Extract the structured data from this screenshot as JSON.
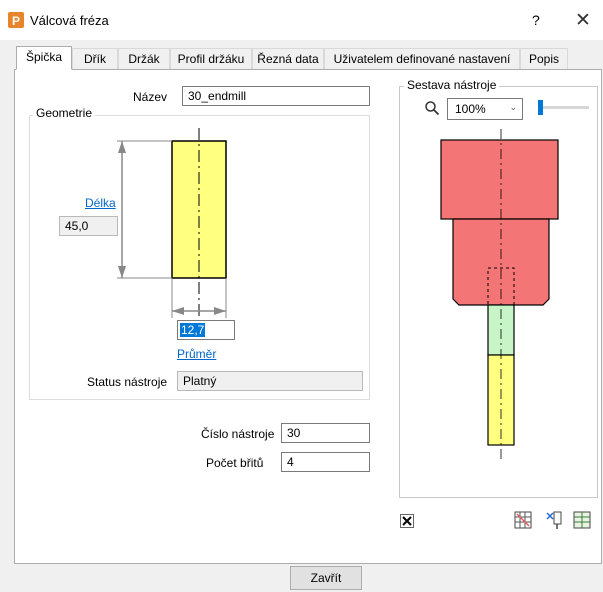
{
  "window": {
    "title": "Válcová fréza",
    "help_label": "?",
    "close_label": "✕"
  },
  "tabs": [
    {
      "label": "Špička",
      "active": true
    },
    {
      "label": "Dřík"
    },
    {
      "label": "Držák"
    },
    {
      "label": "Profil držáku"
    },
    {
      "label": "Řezná data"
    },
    {
      "label": "Uživatelem definované nastavení"
    },
    {
      "label": "Popis"
    }
  ],
  "tip": {
    "name_label": "Název",
    "name_value": "30_endmill",
    "geometry_legend": "Geometrie",
    "length_label": "Délka",
    "length_value": "45,0",
    "diameter_value": "12,7",
    "diameter_label": "Průměr",
    "status_label": "Status nástroje",
    "status_value": "Platný",
    "tool_number_label": "Číslo nástroje",
    "tool_number_value": "30",
    "flutes_label": "Počet břitů",
    "flutes_value": "4"
  },
  "assembly": {
    "legend": "Sestava nástroje",
    "zoom_value": "100%",
    "zoom_level": 0.0
  },
  "footer": {
    "close_button": "Zavřít"
  },
  "colors": {
    "tip_yellow": "#ffff80",
    "holder_red": "#f47575",
    "shank_green": "#c8f5c8",
    "selection_blue": "#0078d7"
  }
}
